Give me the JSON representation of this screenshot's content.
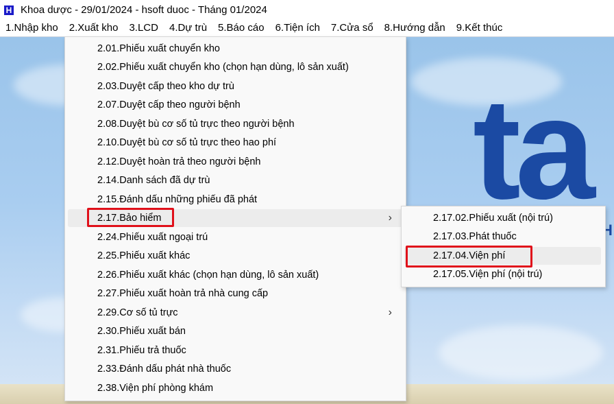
{
  "window": {
    "title": "Khoa dược - 29/01/2024 - hsoft duoc - Tháng 01/2024",
    "icon_glyph": "H",
    "icon_name": "app-h-icon"
  },
  "menubar": [
    {
      "label": "1.Nhập kho"
    },
    {
      "label": "2.Xuất kho"
    },
    {
      "label": "3.LCD"
    },
    {
      "label": "4.Dự trù"
    },
    {
      "label": "5.Báo cáo"
    },
    {
      "label": "6.Tiện ích"
    },
    {
      "label": "7.Cửa sổ"
    },
    {
      "label": "8.Hướng dẫn"
    },
    {
      "label": "9.Kết thúc"
    }
  ],
  "dropdown": [
    {
      "label": "2.01.Phiếu xuất chuyển kho"
    },
    {
      "label": "2.02.Phiếu xuất chuyển kho (chọn hạn dùng, lô sản xuất)"
    },
    {
      "label": "2.03.Duyệt cấp theo kho dự trù"
    },
    {
      "label": "2.07.Duyệt cấp theo người bệnh"
    },
    {
      "label": "2.08.Duyệt bù cơ số tủ trực theo người bệnh"
    },
    {
      "label": "2.10.Duyệt bù cơ số tủ trực theo hao phí"
    },
    {
      "label": "2.12.Duyệt hoàn trả theo người bệnh"
    },
    {
      "label": "2.14.Danh sách đã dự trù"
    },
    {
      "label": "2.15.Đánh dấu những phiếu đã phát"
    },
    {
      "label": "2.17.Bảo hiểm",
      "has_submenu": true
    },
    {
      "label": "2.24.Phiếu xuất ngoại trú"
    },
    {
      "label": "2.25.Phiếu xuất khác"
    },
    {
      "label": "2.26.Phiếu xuất khác (chọn hạn dùng, lô sản xuất)"
    },
    {
      "label": "2.27.Phiếu xuất hoàn trả nhà cung cấp"
    },
    {
      "label": "2.29.Cơ số tủ trực",
      "has_submenu": true
    },
    {
      "label": "2.30.Phiếu xuất bán"
    },
    {
      "label": "2.31.Phiếu trả thuốc"
    },
    {
      "label": "2.33.Đánh dấu phát nhà thuốc"
    },
    {
      "label": "2.38.Viện phí phòng khám"
    }
  ],
  "submenu": [
    {
      "label": "2.17.02.Phiếu xuất (nội trú)"
    },
    {
      "label": "2.17.03.Phát thuốc"
    },
    {
      "label": "2.17.04.Viện phí"
    },
    {
      "label": "2.17.05.Viện phí (nội trú)"
    }
  ],
  "background": {
    "logo_text": "ta",
    "logo_sub": "H"
  },
  "colors": {
    "highlight_border": "#e0101a",
    "logo_blue": "#1b4aa3",
    "app_icon": "#1a1ac8"
  }
}
